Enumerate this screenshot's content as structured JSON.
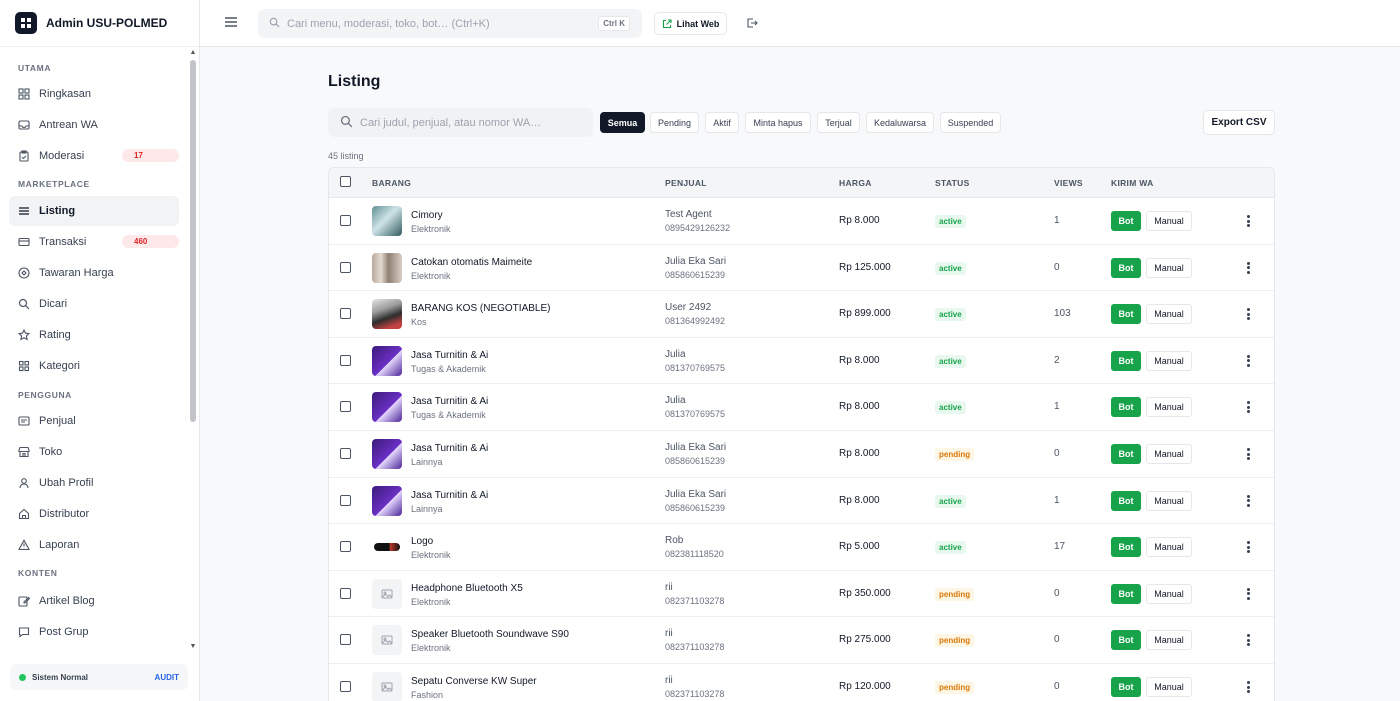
{
  "app": {
    "title": "Admin USU-POLMED"
  },
  "topbar": {
    "search_placeholder": "Cari menu, moderasi, toko, bot… (Ctrl+K)",
    "shortcut": "Ctrl K",
    "view_web_label": "Lihat Web"
  },
  "sidebar": {
    "sections": [
      {
        "label": "UTAMA"
      },
      {
        "label": "MARKETPLACE"
      },
      {
        "label": "PENGGUNA"
      },
      {
        "label": "KONTEN"
      }
    ],
    "items": [
      {
        "label": "Ringkasan",
        "icon": "grid-icon"
      },
      {
        "label": "Antrean WA",
        "icon": "inbox-icon"
      },
      {
        "label": "Moderasi",
        "icon": "clipboard-icon",
        "badge": "17"
      },
      {
        "label": "Listing",
        "icon": "list-icon",
        "active": true
      },
      {
        "label": "Transaksi",
        "icon": "card-icon",
        "badge": "460"
      },
      {
        "label": "Tawaran Harga",
        "icon": "tag-icon"
      },
      {
        "label": "Dicari",
        "icon": "search-icon"
      },
      {
        "label": "Rating",
        "icon": "star-icon"
      },
      {
        "label": "Kategori",
        "icon": "categories-icon"
      },
      {
        "label": "Penjual",
        "icon": "store-icon"
      },
      {
        "label": "Toko",
        "icon": "shop-icon"
      },
      {
        "label": "Ubah Profil",
        "icon": "user-icon"
      },
      {
        "label": "Distributor",
        "icon": "home-icon"
      },
      {
        "label": "Laporan",
        "icon": "warning-icon"
      },
      {
        "label": "Artikel Blog",
        "icon": "edit-icon"
      },
      {
        "label": "Post Grup",
        "icon": "chat-icon"
      }
    ],
    "footer": {
      "status": "Sistem Normal",
      "audit": "AUDIT"
    }
  },
  "main": {
    "title": "Listing",
    "search_placeholder": "Cari judul, penjual, atau nomor WA…",
    "filters": [
      "Semua",
      "Pending",
      "Aktif",
      "Minta hapus",
      "Terjual",
      "Kedaluwarsa",
      "Suspended"
    ],
    "active_filter": "Semua",
    "export_label": "Export CSV",
    "count_label": "45 listing",
    "columns": [
      "BARANG",
      "PENJUAL",
      "HARGA",
      "STATUS",
      "VIEWS",
      "KIRIM WA"
    ],
    "bot_label": "Bot",
    "manual_label": "Manual",
    "rows": [
      {
        "title": "Cimory",
        "category": "Elektronik",
        "seller": "Test Agent",
        "phone": "0895429126232",
        "price": "Rp 8.000",
        "status": "active",
        "views": "1",
        "thumb": "photo-teal"
      },
      {
        "title": "Catokan otomatis Maimeite",
        "category": "Elektronik",
        "seller": "Julia Eka Sari",
        "phone": "085860615239",
        "price": "Rp 125.000",
        "status": "active",
        "views": "0",
        "thumb": "photo-beige"
      },
      {
        "title": "BARANG KOS (NEGOTIABLE)",
        "category": "Kos",
        "seller": "User 2492",
        "phone": "081364992492",
        "price": "Rp 899.000",
        "status": "active",
        "views": "103",
        "thumb": "photo-dark"
      },
      {
        "title": "Jasa Turnitin & Ai",
        "category": "Tugas & Akademik",
        "seller": "Julia",
        "phone": "081370769575",
        "price": "Rp 8.000",
        "status": "active",
        "views": "2",
        "thumb": "photo-purple"
      },
      {
        "title": "Jasa Turnitin & Ai",
        "category": "Tugas & Akademik",
        "seller": "Julia",
        "phone": "081370769575",
        "price": "Rp 8.000",
        "status": "active",
        "views": "1",
        "thumb": "photo-purple"
      },
      {
        "title": "Jasa Turnitin & Ai",
        "category": "Lainnya",
        "seller": "Julia Eka Sari",
        "phone": "085860615239",
        "price": "Rp 8.000",
        "status": "pending",
        "views": "0",
        "thumb": "photo-purple"
      },
      {
        "title": "Jasa Turnitin & Ai",
        "category": "Lainnya",
        "seller": "Julia Eka Sari",
        "phone": "085860615239",
        "price": "Rp 8.000",
        "status": "active",
        "views": "1",
        "thumb": "photo-purple"
      },
      {
        "title": "Logo",
        "category": "Elektronik",
        "seller": "Rob",
        "phone": "082381118520",
        "price": "Rp 5.000",
        "status": "active",
        "views": "17",
        "thumb": "photo-logo"
      },
      {
        "title": "Headphone Bluetooth X5",
        "category": "Elektronik",
        "seller": "rii",
        "phone": "082371103278",
        "price": "Rp 350.000",
        "status": "pending",
        "views": "0",
        "thumb": "placeholder"
      },
      {
        "title": "Speaker Bluetooth Soundwave S90",
        "category": "Elektronik",
        "seller": "rii",
        "phone": "082371103278",
        "price": "Rp 275.000",
        "status": "pending",
        "views": "0",
        "thumb": "placeholder"
      },
      {
        "title": "Sepatu Converse KW Super",
        "category": "Fashion",
        "seller": "rii",
        "phone": "082371103278",
        "price": "Rp 120.000",
        "status": "pending",
        "views": "0",
        "thumb": "placeholder"
      }
    ]
  },
  "colors": {
    "accent": "#111827",
    "bot": "#16a34a",
    "active": "#16a34a",
    "pending": "#d97706",
    "badge": "#dc2626"
  }
}
